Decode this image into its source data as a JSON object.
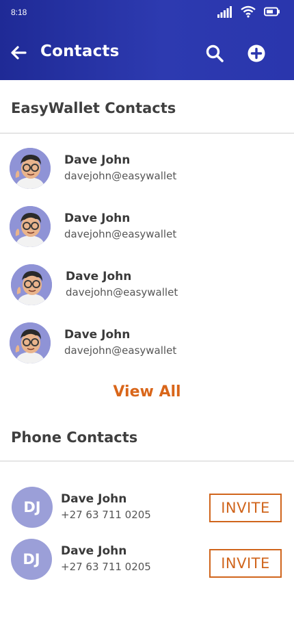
{
  "status_bar": {
    "time": "8:18"
  },
  "header": {
    "title": "Contacts"
  },
  "easywallet_section": {
    "title": "EasyWallet Contacts",
    "contacts": [
      {
        "name": "Dave John",
        "email": "davejohn@easywallet"
      },
      {
        "name": "Dave John",
        "email": "davejohn@easywallet"
      },
      {
        "name": "Dave John",
        "email": "davejohn@easywallet"
      },
      {
        "name": "Dave John",
        "email": "davejohn@easywallet"
      }
    ],
    "view_all": "View All"
  },
  "phone_section": {
    "title": "Phone Contacts",
    "contacts": [
      {
        "initials": "DJ",
        "name": "Dave John",
        "phone": "+27  63 711 0205",
        "action": "INVITE"
      },
      {
        "initials": "DJ",
        "name": "Dave John",
        "phone": "+27  63 711 0205",
        "action": "INVITE"
      }
    ]
  },
  "colors": {
    "header_bg": "#2d3ab0",
    "accent_orange": "#d9661a",
    "avatar_bg": "#8f93d6"
  },
  "icons": [
    "signal-icon",
    "wifi-icon",
    "battery-icon",
    "back-arrow-icon",
    "search-icon",
    "add-circle-icon",
    "memoji-avatar-icon"
  ]
}
